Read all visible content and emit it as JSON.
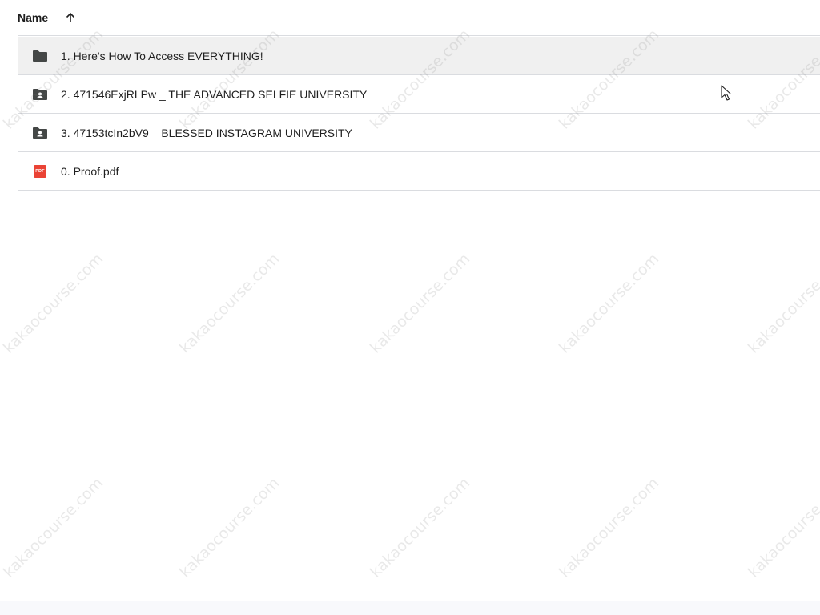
{
  "header": {
    "name_label": "Name",
    "sort_icon": "arrow-up-icon"
  },
  "rows": [
    {
      "label": "1. Here's How To Access EVERYTHING!",
      "icon": "folder-icon",
      "selected": true
    },
    {
      "label": "2. 471546ExjRLPw _ THE ADVANCED SELFIE UNIVERSITY",
      "icon": "shared-folder-icon",
      "selected": false
    },
    {
      "label": "3. 47153tcIn2bV9 _ BLESSED INSTAGRAM UNIVERSITY",
      "icon": "shared-folder-icon",
      "selected": false
    },
    {
      "label": "0. Proof.pdf",
      "icon": "pdf-icon",
      "selected": false
    }
  ],
  "pdf_badge_text": "PDF",
  "watermark_text": "kakaocourse.com",
  "colors": {
    "selected_row": "#f0f0f0",
    "divider": "#dadce0",
    "pdf_red": "#ea4335",
    "icon_gray": "#444746"
  }
}
